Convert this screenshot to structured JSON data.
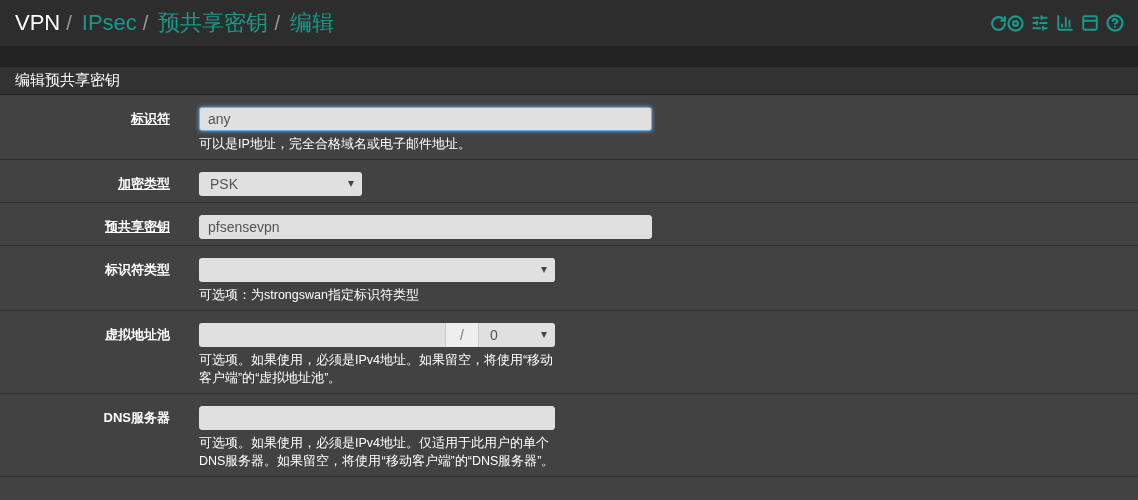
{
  "breadcrumb": [
    {
      "label": "VPN",
      "link": false,
      "separator": "/"
    },
    {
      "label": "IPsec",
      "link": true,
      "separator": "/"
    },
    {
      "label": "预共享密钥",
      "link": true,
      "separator": "/"
    },
    {
      "label": "编辑",
      "link": true
    }
  ],
  "panel": {
    "title": "编辑预共享密钥"
  },
  "fields": [
    {
      "kind": "text",
      "label": "标识符",
      "required": true,
      "value": "any",
      "focused": true,
      "hint": "可以是IP地址，完全合格域名或电子邮件地址。"
    },
    {
      "kind": "select",
      "label": "加密类型",
      "required": true,
      "value": "PSK"
    },
    {
      "kind": "text",
      "label": "预共享密钥",
      "required": true,
      "value": "pfsensevpn",
      "focused": false
    },
    {
      "kind": "select",
      "label": "标识符类型",
      "required": false,
      "hint": "可选项：为strongswan指定标识符类型"
    },
    {
      "kind": "subnet",
      "label": "虚拟地址池",
      "required": false,
      "separator": "/",
      "mask": "0",
      "hint": "可选项。如果使用，必须是IPv4地址。如果留空，将使用“移动客户端”的“虚拟地址池”。"
    },
    {
      "kind": "text",
      "label": "DNS服务器",
      "required": false,
      "focused": false,
      "hint": "可选项。如果使用，必须是IPv4地址。仅适用于此用户的单个DNS服务器。如果留空，将使用“移动客户端”的“DNS服务器”。"
    }
  ]
}
